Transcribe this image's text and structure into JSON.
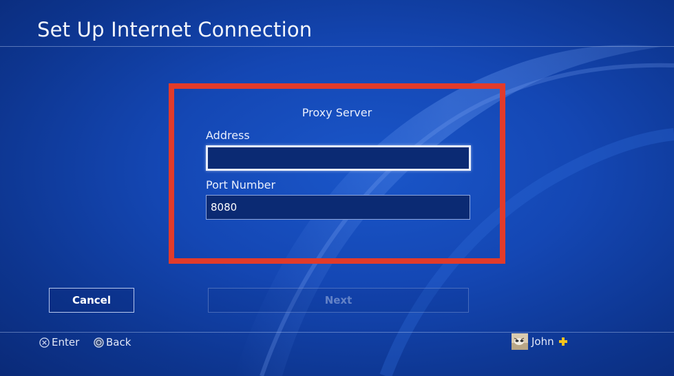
{
  "header": {
    "title": "Set Up Internet Connection"
  },
  "form": {
    "section_title": "Proxy Server",
    "address": {
      "label": "Address",
      "value": ""
    },
    "port": {
      "label": "Port Number",
      "value": "8080"
    }
  },
  "buttons": {
    "cancel_label": "Cancel",
    "next_label": "Next"
  },
  "footer": {
    "enter_label": "Enter",
    "back_label": "Back",
    "user_name": "John",
    "enter_icon": "cross-button-icon",
    "back_icon": "circle-button-icon",
    "plus_icon": "playstation-plus-icon"
  },
  "colors": {
    "highlight": "#e23b2a",
    "plus": "#f5c31c",
    "background": "#1447b4"
  }
}
